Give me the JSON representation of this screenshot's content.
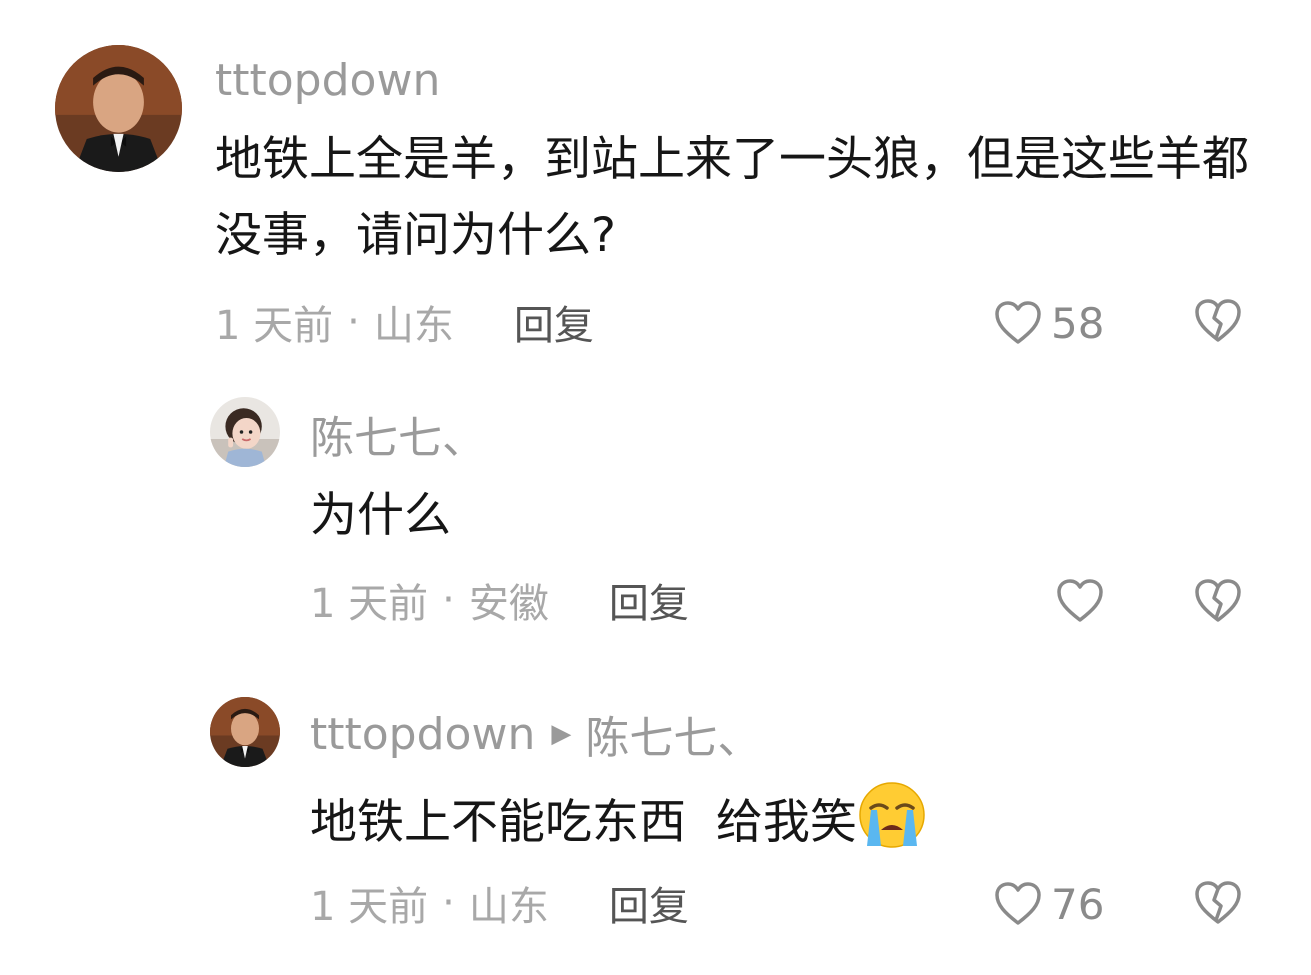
{
  "comments": [
    {
      "username": "tttopdown",
      "text": "地铁上全是羊，到站上来了一头狼，但是这些羊都没事，请问为什么?",
      "time": "1 天前",
      "location": "山东",
      "reply_label": "回复",
      "likes": "58"
    },
    {
      "username": "陈七七、",
      "text": "为什么",
      "time": "1 天前",
      "location": "安徽",
      "reply_label": "回复",
      "likes": ""
    },
    {
      "username": "tttopdown",
      "reply_to": "陈七七、",
      "text": "地铁上不能吃东西  给我笑",
      "emoji": "loudly-crying-face",
      "time": "1 天前",
      "location": "山东",
      "reply_label": "回复",
      "likes": "76"
    }
  ],
  "meta_separator": "·",
  "reply_arrow": "▶"
}
